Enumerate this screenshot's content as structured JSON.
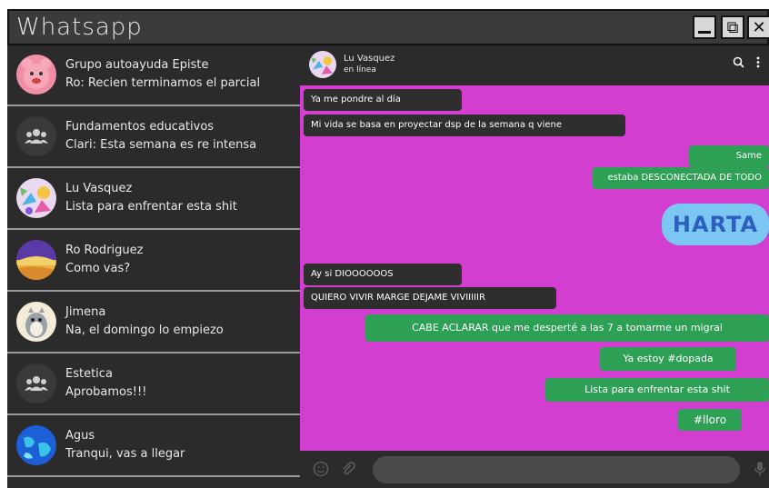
{
  "app": {
    "title": "Whatsapp"
  },
  "window_controls": {
    "minimize": "",
    "restore": "⧉",
    "close": "✕"
  },
  "chats": [
    {
      "name": "Grupo autoayuda Episte",
      "preview": "Ro: Recien terminamos el parcial",
      "avatar": "pink-face-avatar"
    },
    {
      "name": "Fundamentos educativos",
      "preview": "Clari: Esta semana es re intensa",
      "avatar": "group-icon"
    },
    {
      "name": "Lu Vasquez",
      "preview": "Lista para enfrentar esta shit",
      "avatar": "colorful-art-avatar"
    },
    {
      "name": "Ro Rodriguez",
      "preview": "Como vas?",
      "avatar": "landscape-avatar"
    },
    {
      "name": "Jimena",
      "preview": "Na, el domingo lo empiezo",
      "avatar": "totoro-avatar"
    },
    {
      "name": "Estetica",
      "preview": "Aprobamos!!!",
      "avatar": "group-icon"
    },
    {
      "name": "Agus",
      "preview": "Tranqui, vas a llegar",
      "avatar": "globe-avatar"
    }
  ],
  "chat_header": {
    "name": "Lu Vasquez",
    "status": "en línea",
    "search_icon": "search-icon",
    "menu_icon": "kebab-menu-icon"
  },
  "messages": [
    {
      "text": "Ya me pondre al día",
      "direction": "in"
    },
    {
      "text": "Mi vida se basa en proyectar dsp de la semana q viene",
      "direction": "in"
    },
    {
      "text": "Same",
      "direction": "out"
    },
    {
      "text": "estaba DESCONECTADA DE TODO",
      "direction": "out"
    },
    {
      "text": "HARTA",
      "direction": "out"
    },
    {
      "text": "Ay si DIOOOOOOS",
      "direction": "in"
    },
    {
      "text": "QUIERO VIVIR MARGE DEJAME VIVIIIIIR",
      "direction": "in"
    },
    {
      "text": "CABE ACLARAR que me desperté a las 7 a tomarme un migral",
      "direction": "out"
    },
    {
      "text": "Ya estoy #dopada",
      "direction": "out"
    },
    {
      "text": "Lista para enfrentar esta shit",
      "direction": "out"
    },
    {
      "text": "#lloro",
      "direction": "out"
    }
  ],
  "composer": {
    "placeholder": "",
    "emoji_icon": "emoji-icon",
    "attach_icon": "paperclip-icon",
    "mic_icon": "microphone-icon"
  },
  "colors": {
    "chat_bg": "#d23fd0",
    "incoming": "#2e2e2e",
    "outgoing": "#2ea056",
    "sidebar": "#2b2b2b",
    "harta_bubble": "#7cc7f2"
  }
}
